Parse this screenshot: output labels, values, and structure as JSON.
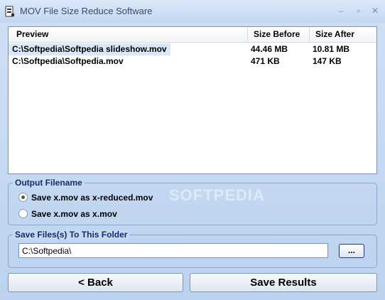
{
  "window": {
    "title": "MOV File Size Reduce Software",
    "controls": {
      "minimize": "–",
      "maximize": "▫",
      "close": "✕"
    }
  },
  "file_list": {
    "columns": [
      "Preview",
      "Size Before",
      "Size After"
    ],
    "rows": [
      {
        "path": "C:\\Softpedia\\Softpedia slideshow.mov",
        "size_before": "44.46 MB",
        "size_after": "10.81 MB",
        "selected": true
      },
      {
        "path": "C:\\Softpedia\\Softpedia.mov",
        "size_before": "471 KB",
        "size_after": "147 KB",
        "selected": false
      }
    ]
  },
  "output_filename": {
    "label": "Output Filename",
    "options": [
      {
        "label": "Save x.mov as x-reduced.mov",
        "checked": true
      },
      {
        "label": "Save x.mov as x.mov",
        "checked": false
      }
    ]
  },
  "save_folder": {
    "label": "Save Files(s) To This Folder",
    "path": "C:\\Softpedia\\",
    "browse_label": "..."
  },
  "buttons": {
    "back_label": "< Back",
    "save_label": "Save Results"
  },
  "watermark": "SOFTPEDIA",
  "colors": {
    "window_bg": "#c6d9f1",
    "group_label": "#102e6b",
    "selection": "#d9e7fa"
  },
  "icons": {
    "app": "app-icon",
    "minimize": "minimize-icon",
    "maximize": "maximize-icon",
    "close": "close-icon"
  }
}
